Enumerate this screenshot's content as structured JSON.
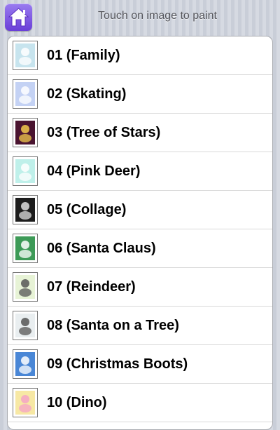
{
  "header": {
    "title": "Touch on image to paint",
    "home_icon": "home-icon",
    "home_color": "#7b55e3"
  },
  "items": [
    {
      "label": "01 (Family)",
      "thumb_bg": "#c7e4ee",
      "thumb_fg": "#ffffff",
      "icon": "family-thumbnail"
    },
    {
      "label": "02 (Skating)",
      "thumb_bg": "#c4d2f4",
      "thumb_fg": "#ffffff",
      "icon": "skating-thumbnail"
    },
    {
      "label": "03 (Tree of Stars)",
      "thumb_bg": "#4a1430",
      "thumb_fg": "#f2c94c",
      "icon": "tree-of-stars-thumbnail"
    },
    {
      "label": "04 (Pink Deer)",
      "thumb_bg": "#bff0ea",
      "thumb_fg": "#ffffff",
      "icon": "pink-deer-thumbnail"
    },
    {
      "label": "05 (Collage)",
      "thumb_bg": "#1c1c1c",
      "thumb_fg": "#dddddd",
      "icon": "collage-thumbnail"
    },
    {
      "label": "06 (Santa Claus)",
      "thumb_bg": "#3d9a57",
      "thumb_fg": "#ffffff",
      "icon": "santa-claus-thumbnail"
    },
    {
      "label": "07 (Reindeer)",
      "thumb_bg": "#e7f3d6",
      "thumb_fg": "#555555",
      "icon": "reindeer-thumbnail"
    },
    {
      "label": "08 (Santa on a Tree)",
      "thumb_bg": "#e9eef0",
      "thumb_fg": "#555555",
      "icon": "santa-on-tree-thumbnail"
    },
    {
      "label": "09 (Christmas Boots)",
      "thumb_bg": "#4a87d6",
      "thumb_fg": "#ffffff",
      "icon": "christmas-boots-thumbnail"
    },
    {
      "label": "10 (Dino)",
      "thumb_bg": "#f7e8a4",
      "thumb_fg": "#f5a3c7",
      "icon": "dino-thumbnail"
    }
  ]
}
